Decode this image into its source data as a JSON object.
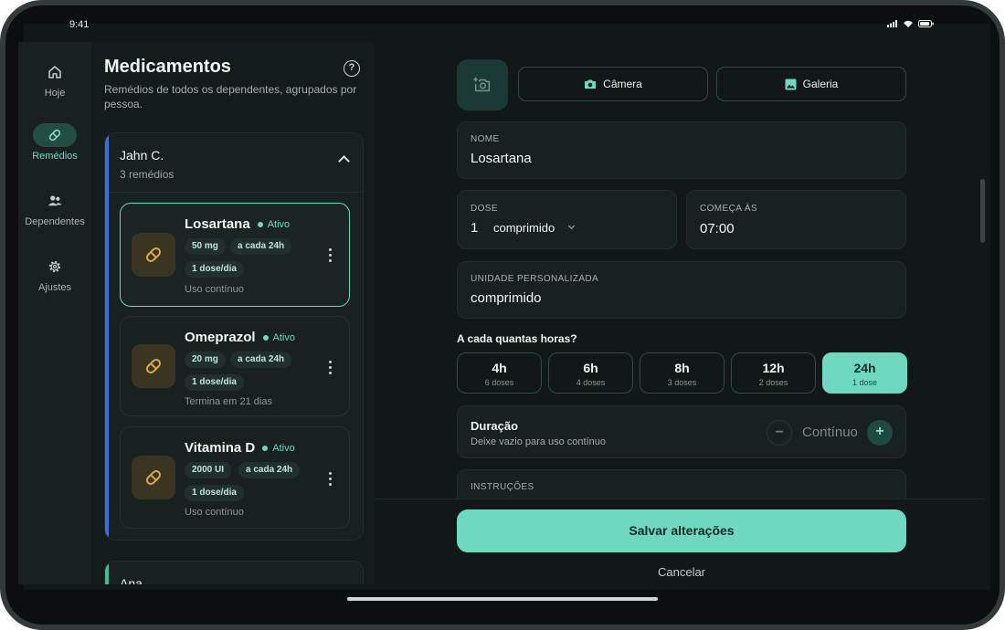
{
  "status_bar": {
    "time": "9:41",
    "icons": [
      "signal-icon",
      "wifi-icon",
      "battery-icon"
    ]
  },
  "nav": {
    "items": [
      {
        "label": "Hoje",
        "icon": "home-icon",
        "active": false
      },
      {
        "label": "Remédios",
        "icon": "pill-icon",
        "active": true
      },
      {
        "label": "Dependentes",
        "icon": "people-icon",
        "active": false
      },
      {
        "label": "Ajustes",
        "icon": "gear-icon",
        "active": false
      }
    ]
  },
  "list": {
    "title": "Medicamentos",
    "subtitle": "Remédios de todos os dependentes, agrupados por pessoa.",
    "groups": [
      {
        "name": "Jahn C.",
        "count": "3 remédios",
        "accent": "#3a6fe0",
        "expanded": true,
        "meds": [
          {
            "name": "Losartana",
            "status": "Ativo",
            "dose": "50 mg",
            "interval": "a cada 24h",
            "per_day": "1 dose/dia",
            "footer": "Uso contínuo",
            "selected": true
          },
          {
            "name": "Omeprazol",
            "status": "Ativo",
            "dose": "20 mg",
            "interval": "a cada 24h",
            "per_day": "1 dose/dia",
            "footer": "Termina em 21 dias",
            "selected": false
          },
          {
            "name": "Vitamina D",
            "status": "Ativo",
            "dose": "2000 UI",
            "interval": "a cada 24h",
            "per_day": "1 dose/dia",
            "footer": "Uso contínuo",
            "selected": false
          }
        ]
      },
      {
        "name": "Ana",
        "accent": "#3fbf8f",
        "expanded": false
      }
    ]
  },
  "form": {
    "photo": {
      "camera_label": "Câmera",
      "gallery_label": "Galeria"
    },
    "name": {
      "label": "NOME",
      "value": "Losartana"
    },
    "dose": {
      "label": "DOSE",
      "value": "1",
      "unit": "comprimido"
    },
    "start": {
      "label": "COMEÇA ÀS",
      "value": "07:00"
    },
    "custom_unit": {
      "label": "UNIDADE PERSONALIZADA",
      "value": "comprimido"
    },
    "interval_question": "A cada quantas horas?",
    "intervals": [
      {
        "label": "4h",
        "doses": "6 doses",
        "active": false
      },
      {
        "label": "6h",
        "doses": "4 doses",
        "active": false
      },
      {
        "label": "8h",
        "doses": "3 doses",
        "active": false
      },
      {
        "label": "12h",
        "doses": "2 doses",
        "active": false
      },
      {
        "label": "24h",
        "doses": "1 dose",
        "active": true
      }
    ],
    "duration": {
      "title": "Duração",
      "hint": "Deixe vazio para uso contínuo",
      "value": "Contínuo",
      "minus": "−",
      "plus": "+"
    },
    "instructions": {
      "label": "INSTRUÇÕES"
    },
    "save_label": "Salvar alterações",
    "cancel_label": "Cancelar"
  },
  "colors": {
    "accent": "#6fd8c1",
    "background": "#111817",
    "pill": "#d9a94a"
  }
}
